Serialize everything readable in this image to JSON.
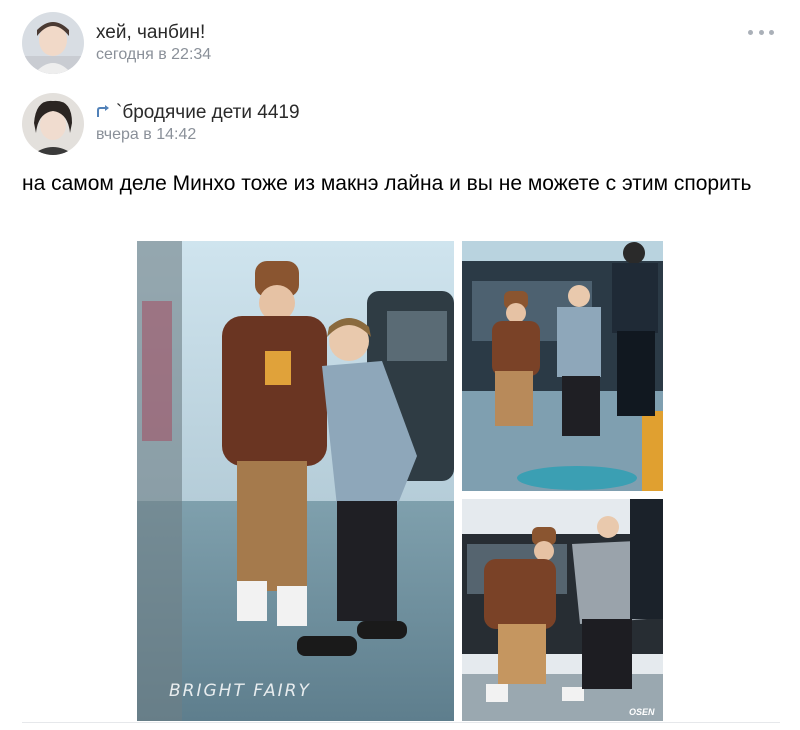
{
  "post": {
    "author": "хей, чанбин!",
    "time": "сегодня в 22:34",
    "menu_icon": "more-horizontal-icon"
  },
  "repost": {
    "icon": "repost-icon",
    "source": "`бродячие дети 4419",
    "time": "вчера в 14:42",
    "text": "на самом деле Минхо тоже из макнэ лайна и вы не можете с этим спорить"
  },
  "photos": {
    "watermark_large": "BRIGHT FAIRY",
    "watermark_small": "OSEN"
  },
  "colors": {
    "name": "#2a2a2a",
    "muted": "#8a9099",
    "accent": "#5181b8"
  }
}
